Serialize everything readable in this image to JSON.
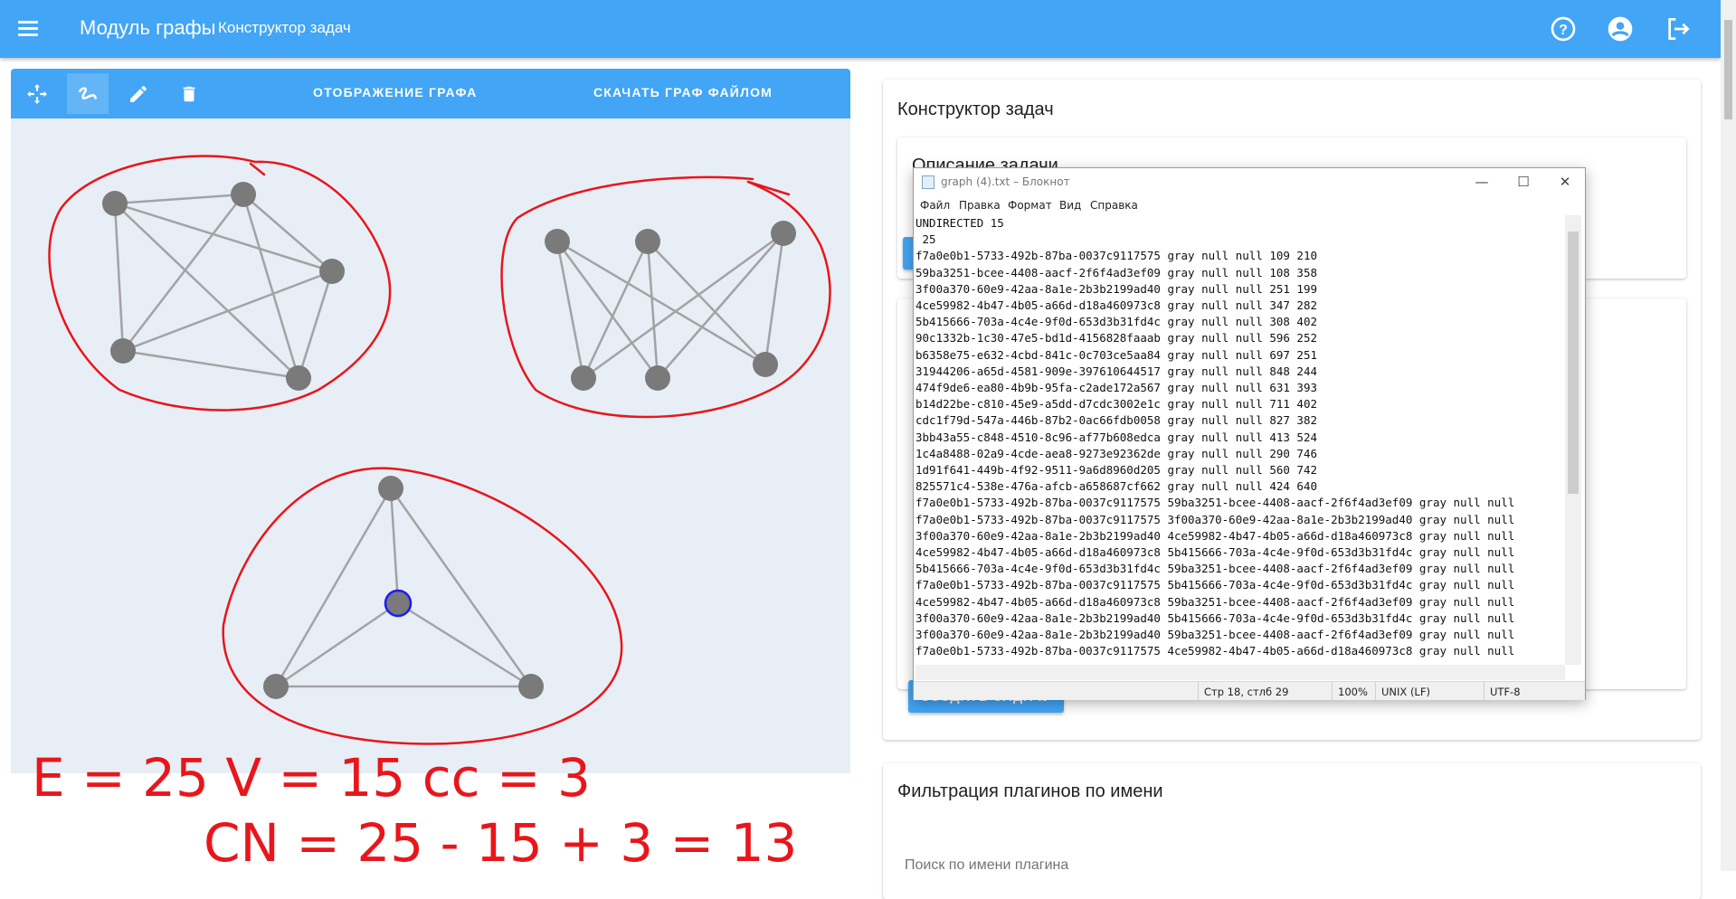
{
  "appbar": {
    "title": "Модуль графы",
    "subtitle": "Конструктор задач",
    "icons": [
      "menu-icon",
      "help-icon",
      "account-icon",
      "logout-icon"
    ]
  },
  "graph_toolbar": {
    "tools": [
      "move-icon",
      "draw-edge-icon",
      "edit-icon",
      "delete-icon"
    ],
    "display_label": "ОТОБРАЖЕНИЕ ГРАФА",
    "download_label": "СКАЧАТЬ ГРАФ ФАЙЛОМ"
  },
  "graph": {
    "node_color": "#7a7a7a",
    "edge_color": "#a3a3a3",
    "selected_outline": "#1a1aff",
    "annotation_color": "#e8161b"
  },
  "handwriting": {
    "line1": "E = 25   V = 15   cc = 3",
    "line2": "CN = 25 - 15 + 3 = 13"
  },
  "constructor": {
    "title": "Конструктор задач",
    "description_title": "Описание задачи",
    "create_button": "СОЗДАТЬ ЗАДАЧУ"
  },
  "filter": {
    "title": "Фильтрация плагинов по имени",
    "placeholder": "Поиск по имени плагина"
  },
  "notepad": {
    "title": "graph (4).txt – Блокнот",
    "menu": [
      "Файл",
      "Правка",
      "Формат",
      "Вид",
      "Справка"
    ],
    "content": "UNDIRECTED 15\n 25\nf7a0e0b1-5733-492b-87ba-0037c9117575 gray null null 109 210\n59ba3251-bcee-4408-aacf-2f6f4ad3ef09 gray null null 108 358\n3f00a370-60e9-42aa-8a1e-2b3b2199ad40 gray null null 251 199\n4ce59982-4b47-4b05-a66d-d18a460973c8 gray null null 347 282\n5b415666-703a-4c4e-9f0d-653d3b31fd4c gray null null 308 402\n90c1332b-1c30-47e5-bd1d-4156828faaab gray null null 596 252\nb6358e75-e632-4cbd-841c-0c703ce5aa84 gray null null 697 251\n31944206-a65d-4581-909e-397610644517 gray null null 848 244\n474f9de6-ea80-4b9b-95fa-c2ade172a567 gray null null 631 393\nb14d22be-c810-45e9-a5dd-d7cdc3002e1c gray null null 711 402\ncdc1f79d-547a-446b-87b2-0ac66fdb0058 gray null null 827 382\n3bb43a55-c848-4510-8c96-af77b608edca gray null null 413 524\n1c4a8488-02a9-4cde-aea8-9273e92362de gray null null 290 746\n1d91f641-449b-4f92-9511-9a6d8960d205 gray null null 560 742\n825571c4-538e-476a-afcb-a658687cf662 gray null null 424 640\nf7a0e0b1-5733-492b-87ba-0037c9117575 59ba3251-bcee-4408-aacf-2f6f4ad3ef09 gray null null\nf7a0e0b1-5733-492b-87ba-0037c9117575 3f00a370-60e9-42aa-8a1e-2b3b2199ad40 gray null null\n3f00a370-60e9-42aa-8a1e-2b3b2199ad40 4ce59982-4b47-4b05-a66d-d18a460973c8 gray null null\n4ce59982-4b47-4b05-a66d-d18a460973c8 5b415666-703a-4c4e-9f0d-653d3b31fd4c gray null null\n5b415666-703a-4c4e-9f0d-653d3b31fd4c 59ba3251-bcee-4408-aacf-2f6f4ad3ef09 gray null null\nf7a0e0b1-5733-492b-87ba-0037c9117575 5b415666-703a-4c4e-9f0d-653d3b31fd4c gray null null\n4ce59982-4b47-4b05-a66d-d18a460973c8 59ba3251-bcee-4408-aacf-2f6f4ad3ef09 gray null null\n3f00a370-60e9-42aa-8a1e-2b3b2199ad40 5b415666-703a-4c4e-9f0d-653d3b31fd4c gray null null\n3f00a370-60e9-42aa-8a1e-2b3b2199ad40 59ba3251-bcee-4408-aacf-2f6f4ad3ef09 gray null null\nf7a0e0b1-5733-492b-87ba-0037c9117575 4ce59982-4b47-4b05-a66d-d18a460973c8 gray null null",
    "status": {
      "position": "Стр 18, стлб 29",
      "zoom": "100%",
      "eol": "UNIX (LF)",
      "encoding": "UTF-8"
    }
  }
}
